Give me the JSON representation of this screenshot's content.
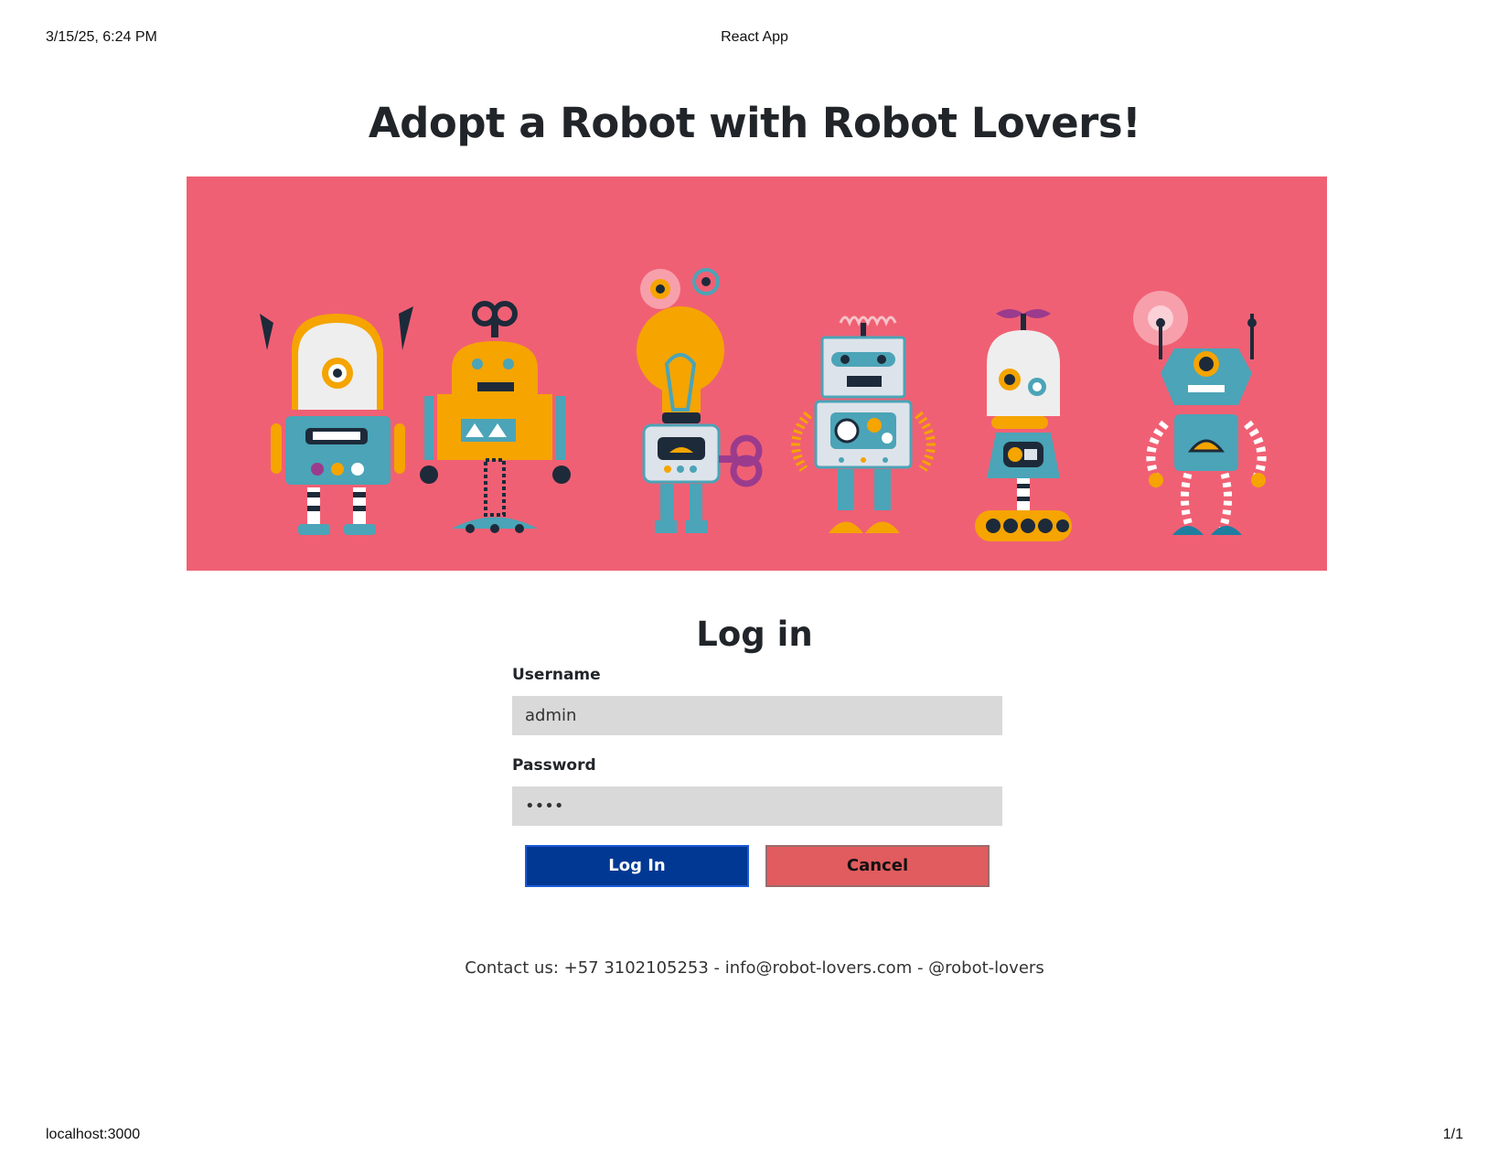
{
  "print_header": {
    "datetime": "3/15/25, 6:24 PM",
    "page_title": "React App"
  },
  "print_footer": {
    "url": "localhost:3000",
    "page_count": "1/1"
  },
  "header": {
    "title": "Adopt a Robot with Robot Lovers!"
  },
  "banner": {
    "background_color": "#f06074",
    "robot_count": 6
  },
  "login": {
    "title": "Log in",
    "username_label": "Username",
    "username_value": "admin",
    "password_label": "Password",
    "password_value": "••••",
    "login_button": "Log In",
    "cancel_button": "Cancel"
  },
  "colors": {
    "login_button": "#003893",
    "cancel_button": "#e05c5e",
    "input_background": "#d9d9d9"
  },
  "footer": {
    "contact": "Contact us: +57 3102105253 - info@robot-lovers.com - @robot-lovers"
  }
}
